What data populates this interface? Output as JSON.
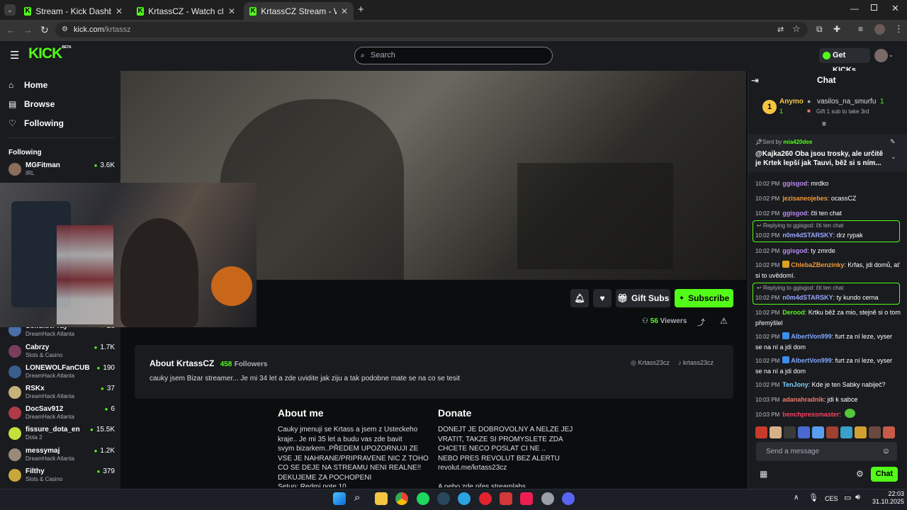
{
  "browser": {
    "tabs": [
      {
        "title": "Stream - Kick Dashboard"
      },
      {
        "title": "KrtassCZ - Watch clips on Kick"
      },
      {
        "title": "KrtassCZ Stream - Watch Li"
      }
    ],
    "url_host": "kick.com",
    "url_path": "/krtassz"
  },
  "header": {
    "logo": "KICK",
    "logo_beta": "BETA",
    "search_placeholder": "Search",
    "get_kicks": "Get KICKs"
  },
  "sidebar": {
    "nav": [
      {
        "label": "Home",
        "icon": "home-icon"
      },
      {
        "label": "Browse",
        "icon": "browse-icon"
      },
      {
        "label": "Following",
        "icon": "heart-icon"
      }
    ],
    "following_title": "Following",
    "following": [
      {
        "name": "MGFitman",
        "category": "IRL",
        "viewers": "3.6K",
        "color": "#8a6d5a"
      },
      {
        "name": "SenditNPray",
        "category": "DreamHack Atlanta",
        "viewers": "28",
        "color": "#4a6ea8"
      },
      {
        "name": "Cabrzy",
        "category": "Slots & Casino",
        "viewers": "1.7K",
        "color": "#7a3e5c"
      },
      {
        "name": "LONEWOLFanCUB",
        "category": "DreamHack Atlanta",
        "viewers": "190",
        "color": "#3a5e8c"
      },
      {
        "name": "RSKx",
        "category": "DreamHack Atlanta",
        "viewers": "37",
        "color": "#c9b27a"
      },
      {
        "name": "DocSav912",
        "category": "DreamHack Atlanta",
        "viewers": "6",
        "color": "#b03a48"
      },
      {
        "name": "fissure_dota_en",
        "category": "Dota 2",
        "viewers": "15.5K",
        "color": "#c2e23a"
      },
      {
        "name": "messymaj",
        "category": "DreamHack Atlanta",
        "viewers": "1.2K",
        "color": "#9a8a7a"
      },
      {
        "name": "Filthy",
        "category": "Slots & Casino",
        "viewers": "379",
        "color": "#c8a83a"
      }
    ]
  },
  "stream": {
    "gift_subs": "Gift Subs",
    "subscribe": "Subscribe",
    "viewers_count": "56",
    "viewers_label": "Viewers"
  },
  "about_box": {
    "title": "About KrtassCZ",
    "followers_count": "458",
    "followers_label": "Followers",
    "bio": "cauky jsem Bizar streamer... Je mi 34 let a zde uvidite jak ziju a tak podobne mate se na co se tesit",
    "socials": [
      "Krtass23cz",
      "krtass23cz"
    ]
  },
  "panels": {
    "about_title": "About me",
    "about_lines": [
      "Cauky jmenuji se Krtass a jsem z Usteckeho",
      "kraje.. Je mi 35 let a budu vas zde bavit",
      "svym bizarkem..PŘEDEM UPOZORNUJI ZE",
      "VSE JE NAHRANE/PRIPRAVENE NIC Z TOHO",
      "CO SE DEJE NA STREAMU NENI REALNE!!",
      "DEKUJEME ZA POCHOPENI",
      "Setup: Redmi note 10"
    ],
    "donate_title": "Donate",
    "donate_lines": [
      "DONEJT JE DOBROVOLNY A NELZE JEJ",
      "VRATIT, TAKZE SI PROMYSLETE ZDA",
      "CHCETE NECO POSLAT CI NE ..",
      "NEBO PRES REVOLUT BEZ ALERTU",
      "revolut.me/krtass23cz",
      "",
      "A nebo zde přes streamlabs"
    ]
  },
  "chat": {
    "title": "Chat",
    "leaderboard": {
      "rank": "1",
      "user1": "Anymo",
      "user1_count": "1",
      "user2": "vasilos_na_smurfu",
      "user2_count": "1",
      "gift_note": "Gift 1 sub to take 3rd"
    },
    "pinned": {
      "sent_by_label": "Sent by",
      "sent_by": "mia420dee",
      "text": "@Kajka260 Oba jsou trosky, ale určitě je Krtek lepší jak Tauvi, běž si s ním..."
    },
    "messages": [
      {
        "time": "10:02 PM",
        "user": "ggisgod",
        "color": "#b98cf0",
        "text": "mrdko"
      },
      {
        "time": "10:02 PM",
        "user": "jezisaneojebes",
        "color": "#f39a3a",
        "text": "ocassCZ"
      },
      {
        "time": "10:02 PM",
        "user": "ggisgod",
        "color": "#b98cf0",
        "text": "čti ten chat"
      },
      {
        "time": "10:02 PM",
        "user": "n0m4dSTARSKY",
        "color": "#9aa8ff",
        "text": "drz rypak",
        "reply": "Replying to ggisgod: čti ten chat"
      },
      {
        "time": "10:02 PM",
        "user": "ggisgod",
        "color": "#b98cf0",
        "text": "ty zmrde"
      },
      {
        "time": "10:02 PM",
        "user": "ChlebaZBenzinky",
        "color": "#f39a3a",
        "text": "Krfas, jdi domů, ať si to uvědomí."
      },
      {
        "time": "10:02 PM",
        "user": "n0m4dSTARSKY",
        "color": "#9aa8ff",
        "text": "ty kundo cerna",
        "reply": "Replying to ggisgod: čti ten chat"
      },
      {
        "time": "10:02 PM",
        "user": "Derood",
        "color": "#53fc18",
        "text": "Krtku běž za mio, stejně si o tom přemýšlel"
      },
      {
        "time": "10:02 PM",
        "user": "AlbertVon999",
        "color": "#7fa8ff",
        "text": "furt za ní leze, vyser se na ní a jdi dom"
      },
      {
        "time": "10:02 PM",
        "user": "AlbertVon999",
        "color": "#7fa8ff",
        "text": "furt za ní leze, vyser se na ní a jdi dom"
      },
      {
        "time": "10:02 PM",
        "user": "TenJony",
        "color": "#7fd0ff",
        "text": "Kde je ten Sabky nabiječ?"
      },
      {
        "time": "10:03 PM",
        "user": "adanahradnik",
        "color": "#f07a6a",
        "text": "jdi k sabce"
      },
      {
        "time": "10:03 PM",
        "user": "benchpressmaster",
        "color": "#ff4060",
        "text": ""
      }
    ],
    "input_placeholder": "Send a message",
    "send_label": "Chat"
  },
  "taskbar": {
    "lang": "CES",
    "time": "22:03",
    "date": "31.10.2025"
  }
}
